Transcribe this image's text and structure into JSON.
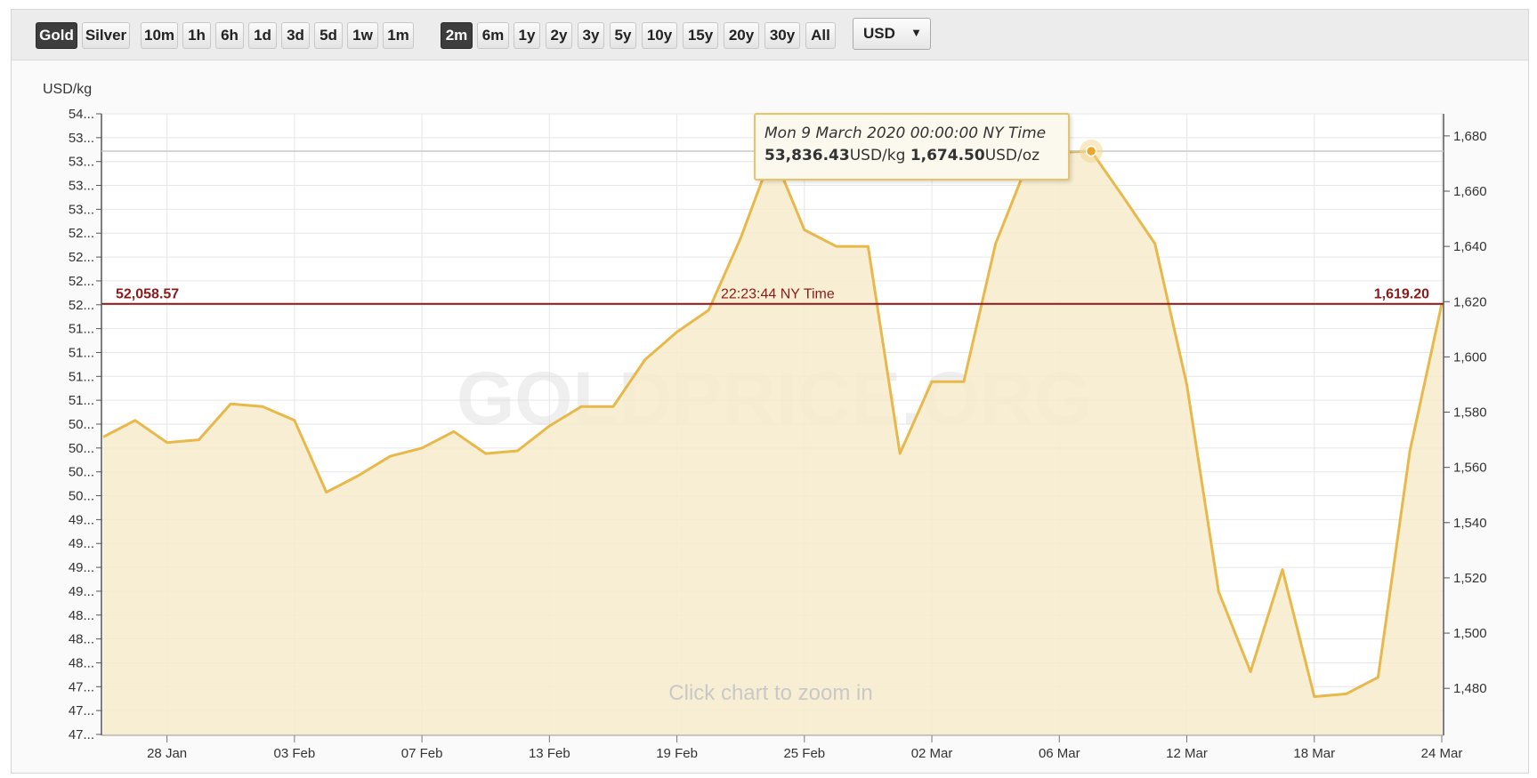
{
  "toolbar": {
    "metals": [
      {
        "label": "Gold",
        "active": true
      },
      {
        "label": "Silver",
        "active": false
      }
    ],
    "ranges": [
      {
        "label": "10m",
        "active": false
      },
      {
        "label": "1h",
        "active": false
      },
      {
        "label": "6h",
        "active": false
      },
      {
        "label": "1d",
        "active": false
      },
      {
        "label": "3d",
        "active": false
      },
      {
        "label": "5d",
        "active": false
      },
      {
        "label": "1w",
        "active": false
      },
      {
        "label": "1m",
        "active": false
      },
      {
        "label": "2m",
        "active": true
      },
      {
        "label": "6m",
        "active": false
      },
      {
        "label": "1y",
        "active": false
      },
      {
        "label": "2y",
        "active": false
      },
      {
        "label": "3y",
        "active": false
      },
      {
        "label": "5y",
        "active": false
      },
      {
        "label": "10y",
        "active": false
      },
      {
        "label": "15y",
        "active": false
      },
      {
        "label": "20y",
        "active": false
      },
      {
        "label": "30y",
        "active": false
      },
      {
        "label": "All",
        "active": false
      }
    ],
    "currency": "USD",
    "caret": "▼"
  },
  "colors": {
    "line": "#e8b84a",
    "fill": "#f7ebcc",
    "current_line": "#8b1a1a",
    "active_button": "#3d3d3d"
  },
  "chart_data": {
    "type": "area",
    "left_axis_unit": "USD/kg",
    "left_ticks": [
      "54...",
      "53...",
      "53...",
      "53...",
      "53...",
      "52...",
      "52...",
      "52...",
      "52...",
      "51...",
      "51...",
      "51...",
      "51...",
      "50...",
      "50...",
      "50...",
      "50...",
      "49...",
      "49...",
      "49...",
      "49...",
      "48...",
      "48...",
      "48...",
      "47...",
      "47...",
      "47..."
    ],
    "right_axis": {
      "unit": "USD/oz",
      "ticks": [
        1680,
        1660,
        1640,
        1620,
        1600,
        1580,
        1560,
        1540,
        1520,
        1500,
        1480
      ],
      "range": [
        1463,
        1688
      ]
    },
    "x_ticks": [
      "28 Jan",
      "03 Feb",
      "07 Feb",
      "13 Feb",
      "19 Feb",
      "25 Feb",
      "02 Mar",
      "06 Mar",
      "12 Mar",
      "18 Mar",
      "24 Mar"
    ],
    "series": [
      {
        "unit": "USD/oz",
        "points": [
          [
            "2020-01-24",
            1571
          ],
          [
            "2020-01-27",
            1577
          ],
          [
            "2020-01-28",
            1569
          ],
          [
            "2020-01-29",
            1570
          ],
          [
            "2020-01-30",
            1583
          ],
          [
            "2020-01-31",
            1582
          ],
          [
            "2020-02-03",
            1577
          ],
          [
            "2020-02-04",
            1551
          ],
          [
            "2020-02-05",
            1557
          ],
          [
            "2020-02-06",
            1564
          ],
          [
            "2020-02-07",
            1567
          ],
          [
            "2020-02-10",
            1573
          ],
          [
            "2020-02-11",
            1565
          ],
          [
            "2020-02-12",
            1566
          ],
          [
            "2020-02-13",
            1575
          ],
          [
            "2020-02-14",
            1582
          ],
          [
            "2020-02-17",
            1582
          ],
          [
            "2020-02-18",
            1599
          ],
          [
            "2020-02-19",
            1609
          ],
          [
            "2020-02-20",
            1617
          ],
          [
            "2020-02-21",
            1643
          ],
          [
            "2020-02-24",
            1674
          ],
          [
            "2020-02-25",
            1646
          ],
          [
            "2020-02-26",
            1640
          ],
          [
            "2020-02-27",
            1640
          ],
          [
            "2020-02-28",
            1565
          ],
          [
            "2020-03-02",
            1591
          ],
          [
            "2020-03-03",
            1591
          ],
          [
            "2020-03-04",
            1641
          ],
          [
            "2020-03-05",
            1670
          ],
          [
            "2020-03-06",
            1674
          ],
          [
            "2020-03-09",
            1674.5
          ],
          [
            "2020-03-10",
            1658
          ],
          [
            "2020-03-11",
            1641
          ],
          [
            "2020-03-12",
            1590
          ],
          [
            "2020-03-13",
            1515
          ],
          [
            "2020-03-16",
            1486
          ],
          [
            "2020-03-17",
            1523
          ],
          [
            "2020-03-18",
            1477
          ],
          [
            "2020-03-19",
            1478
          ],
          [
            "2020-03-20",
            1484
          ],
          [
            "2020-03-23",
            1566
          ],
          [
            "2020-03-24",
            1619.2
          ]
        ]
      }
    ],
    "current": {
      "left_label": "52,058.57",
      "time_label": "22:23:44 NY Time",
      "right_label": "1,619.20",
      "value": 1619.2
    },
    "tooltip": {
      "date": "Mon 9 March 2020 00:00:00 NY Time",
      "kg_value": "53,836.43",
      "kg_unit": "USD/kg",
      "oz_value": "1,674.50",
      "oz_unit": "USD/oz",
      "point_date": "2020-03-09",
      "point_value": 1674.5
    },
    "watermark": "GOLDPRICE.ORG",
    "zoom_hint": "Click chart to zoom in",
    "grid": true
  }
}
